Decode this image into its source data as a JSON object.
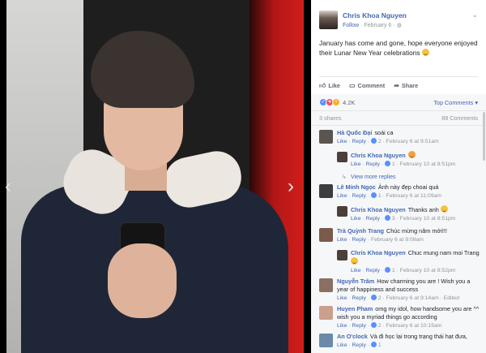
{
  "viewer": {
    "prev_icon": "chevron-left-icon",
    "next_icon": "chevron-right-icon"
  },
  "post": {
    "author": "Chris Khoa Nguyen",
    "follow": "Follow",
    "date": "February 6",
    "privacy_icon": "globe-icon",
    "text": "January has come and gone, hope everyone enjoyed their Lunar New Year celebrations"
  },
  "actions": {
    "like": "Like",
    "comment": "Comment",
    "share": "Share"
  },
  "reactions": {
    "count": "4.2K",
    "top_comments": "Top Comments ▾"
  },
  "stats": {
    "shares": "3 shares",
    "comments": "89 Comments"
  },
  "comments": [
    {
      "name": "Hà Quốc Đại",
      "text": "soái ca",
      "like": "Like",
      "reply": "Reply",
      "likes": "2",
      "time": "February 6 at 9:51am",
      "reply_to": false
    },
    {
      "name": "Chris Khoa Nguyen",
      "text": "",
      "like": "Like",
      "reply": "Reply",
      "likes": "1",
      "time": "February 10 at 8:51pm",
      "reply_to": true
    },
    {
      "name": "Lê Minh Ngọc",
      "text": "Ảnh này đẹp choai quá",
      "like": "Like",
      "reply": "Reply",
      "likes": "1",
      "time": "February 6 at 11:09am",
      "reply_to": false
    },
    {
      "name": "Chris Khoa Nguyen",
      "text": "Thanks anh",
      "like": "Like",
      "reply": "Reply",
      "likes": "3",
      "time": "February 10 at 8:51pm",
      "reply_to": true
    },
    {
      "name": "Trà Quỳnh Trang",
      "text": "Chúc mừng năm mới!!!",
      "like": "Like",
      "reply": "Reply",
      "likes": "",
      "time": "February 6 at 9:08am",
      "reply_to": false
    },
    {
      "name": "Chris Khoa Nguyen",
      "text": "Chuc mung nam moi Trang",
      "like": "Like",
      "reply": "Reply",
      "likes": "1",
      "time": "February 10 at 8:52pm",
      "reply_to": true
    },
    {
      "name": "Nguyễn Trâm",
      "text": "How charming you are ! Wish you a year of happiness and success",
      "like": "Like",
      "reply": "Reply",
      "likes": "2",
      "time": "February 6 at 9:14am",
      "edited": "Edited",
      "reply_to": false
    },
    {
      "name": "Huyen Pham",
      "text": "omg my idol, how handsome you are ^^ wish you a myriad things go according",
      "like": "Like",
      "reply": "Reply",
      "likes": "2",
      "time": "February 6 at 10:15am",
      "reply_to": false
    },
    {
      "name": "An O'clock",
      "text": "Và đi học lại trong trạng thái hạt đưa,",
      "like": "Like",
      "reply": "Reply",
      "likes": "1",
      "time": "",
      "reply_to": false
    }
  ],
  "view_more": "View more replies"
}
